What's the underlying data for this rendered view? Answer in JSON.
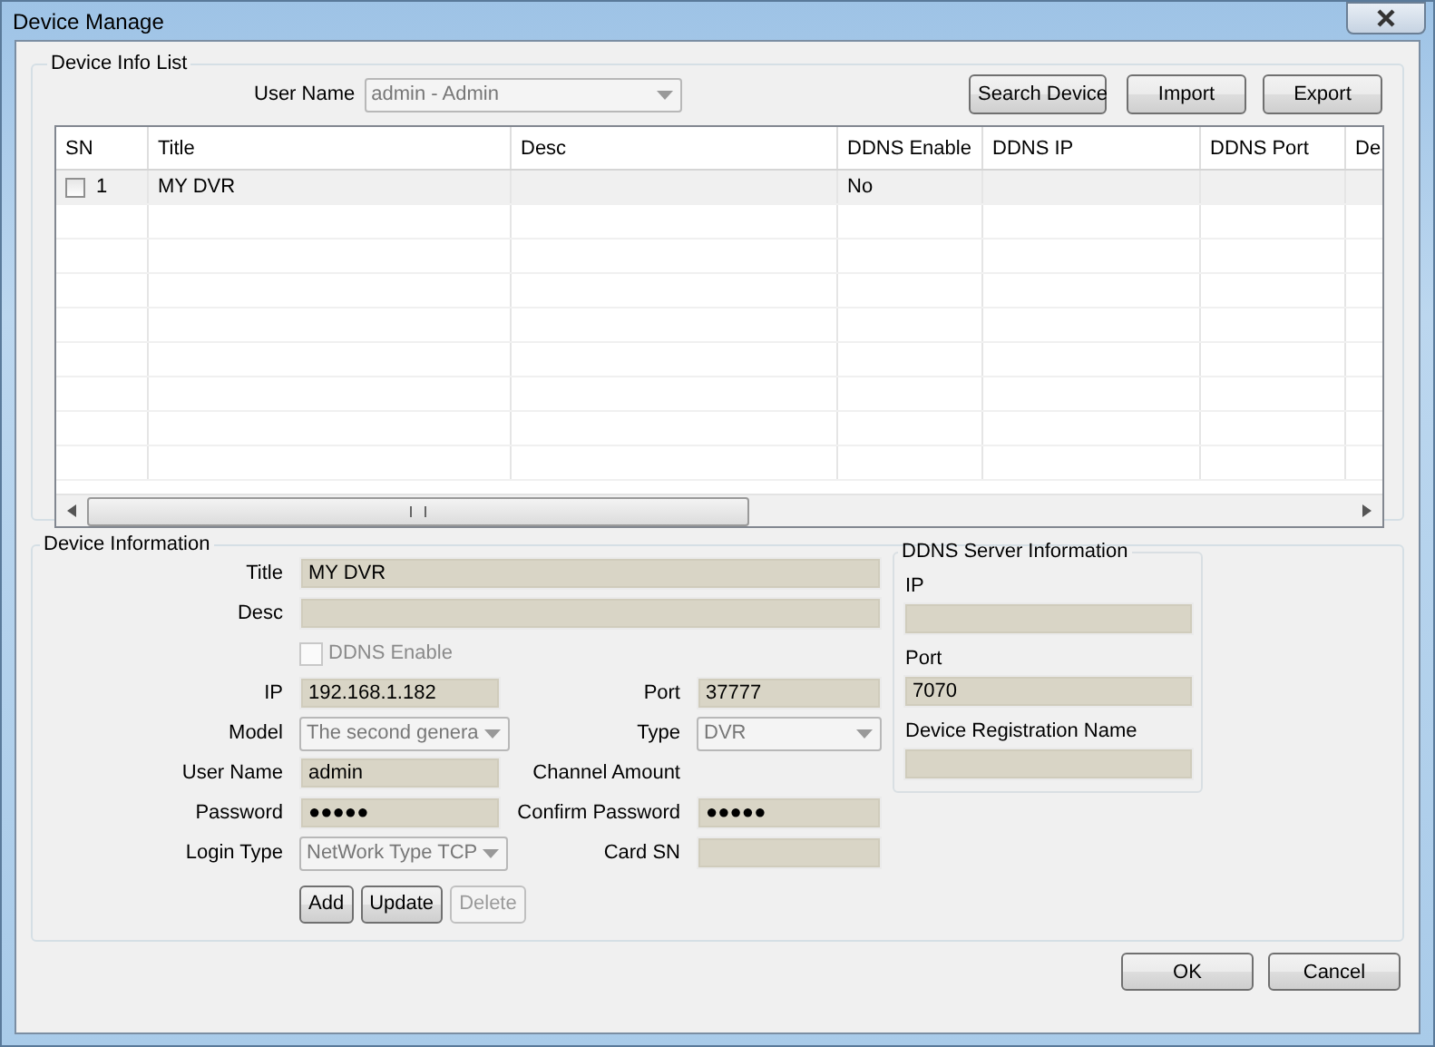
{
  "window": {
    "title": "Device Manage"
  },
  "device_list": {
    "title": "Device Info List",
    "user_name_label": "User Name",
    "user_name": "admin - Admin",
    "user_name_disabled": true,
    "buttons": [
      "Search Device",
      "Import",
      "Export"
    ],
    "columns": [
      "SN",
      "Title",
      "Desc",
      "DDNS Enable",
      "DDNS IP",
      "DDNS Port",
      "De"
    ],
    "rows": [
      {
        "checked": false,
        "sn": "1",
        "title": "MY DVR",
        "ddns_enable": "No"
      }
    ]
  },
  "device_info": {
    "title": "Device Information",
    "rows": [
      [
        {
          "kind": "text",
          "label": "Title",
          "value": "MY DVR",
          "wide": true
        }
      ],
      [
        {
          "kind": "text",
          "label": "Desc",
          "wide": true
        }
      ],
      [
        {
          "kind": "check",
          "label": "DDNS Enable",
          "checked": false,
          "disabled": true
        }
      ],
      [
        {
          "kind": "text",
          "label": "IP",
          "value": "192.168.1.182"
        },
        {
          "kind": "text",
          "label": "Port",
          "value": "37777"
        }
      ],
      [
        {
          "kind": "combo",
          "label": "Model",
          "value": "The second genera",
          "disabled": true
        },
        {
          "kind": "combo",
          "label": "Type",
          "value": "DVR",
          "disabled": true
        }
      ],
      [
        {
          "kind": "text",
          "label": "User Name",
          "value": "admin"
        },
        {
          "kind": "label",
          "label": "Channel Amount"
        }
      ],
      [
        {
          "kind": "text",
          "label": "Password",
          "value": "●●●●●"
        },
        {
          "kind": "text",
          "label": "Confirm Password",
          "value": "●●●●●"
        }
      ],
      [
        {
          "kind": "combo",
          "label": "Login Type",
          "value": "NetWork Type TCP",
          "disabled": true
        },
        {
          "kind": "text",
          "label": "Card SN"
        }
      ]
    ],
    "buttons": [
      {
        "label": "Add",
        "disabled": false
      },
      {
        "label": "Update",
        "disabled": false
      },
      {
        "label": "Delete",
        "disabled": true
      }
    ]
  },
  "ddns_server": {
    "title": "DDNS Server Information",
    "fields": [
      {
        "label": "IP"
      },
      {
        "label": "Port",
        "value": "7070"
      },
      {
        "label": "Device Registration Name"
      }
    ]
  },
  "footer_buttons": [
    "OK",
    "Cancel"
  ]
}
